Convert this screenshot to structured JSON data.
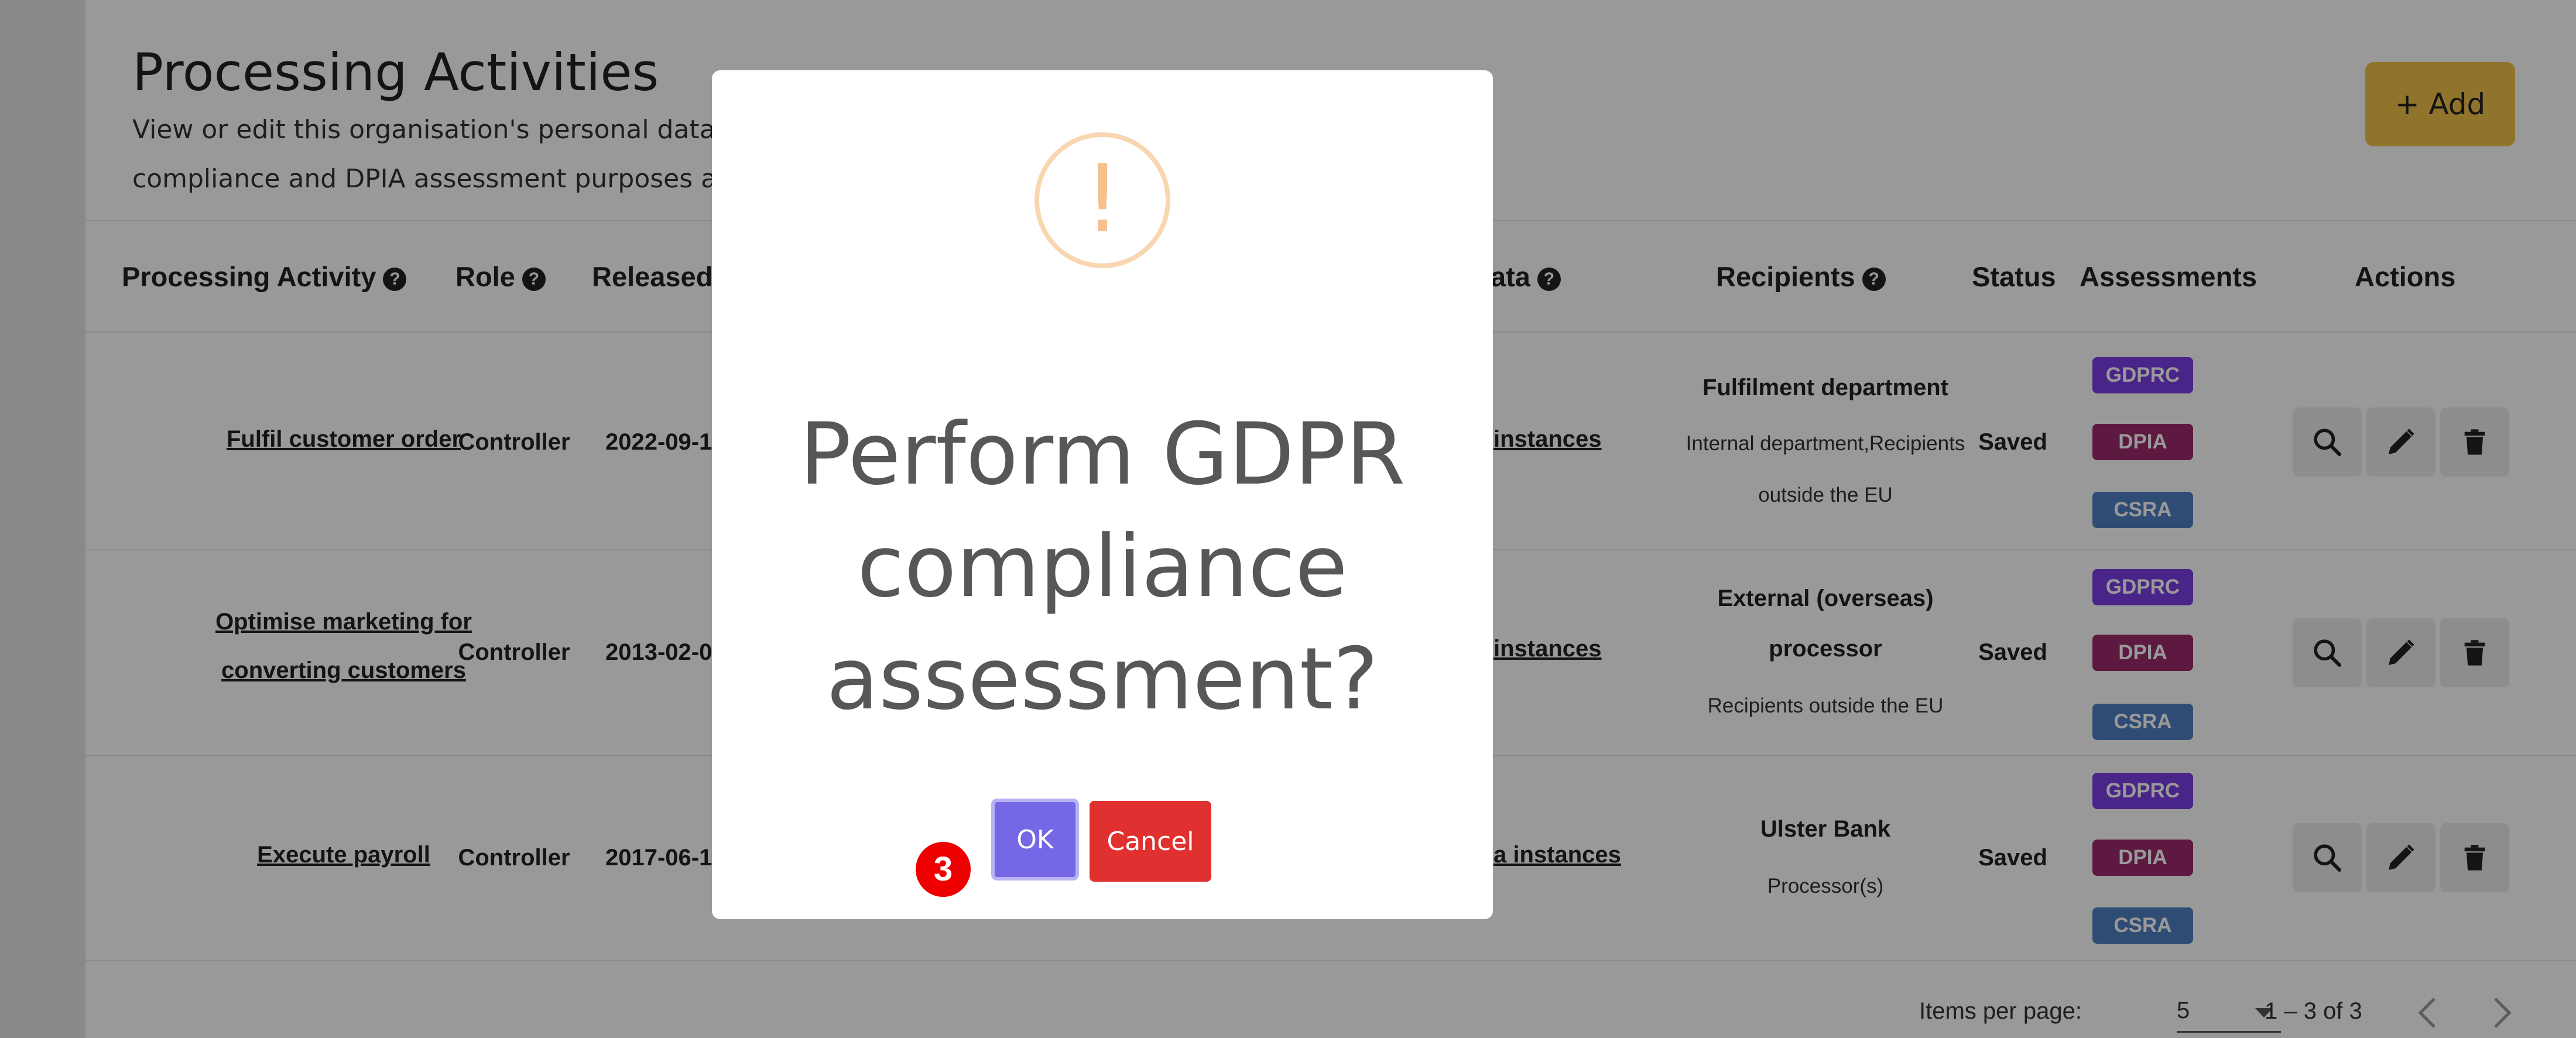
{
  "page": {
    "title": "Processing Activities",
    "description_line1": "View or edit this organisation's personal data proc",
    "description_line2": "compliance and DPIA assessment purposes as we",
    "add_label": "+ Add"
  },
  "table": {
    "headers": {
      "activity": "Processing Activity",
      "role": "Role",
      "released": "Released",
      "data": "ata",
      "recipients": "Recipients",
      "status": "Status",
      "assessments": "Assessments",
      "actions": "Actions"
    },
    "help_glyph": "?",
    "rows": [
      {
        "activity": "Fulfil customer order",
        "role": "Controller",
        "released": "2022-09-1",
        "data_link": "instances",
        "recipient_main": "Fulfilment department",
        "recipient_sub1": "Internal department,Recipients",
        "recipient_sub2": "outside the EU",
        "status": "Saved"
      },
      {
        "activity_line1": "Optimise marketing for",
        "activity_line2": "converting customers",
        "role": "Controller",
        "released": "2013-02-0",
        "data_link": "instances",
        "recipient_main_line1": "External (overseas)",
        "recipient_main_line2": "processor",
        "recipient_sub1": "Recipients outside the EU",
        "status": "Saved"
      },
      {
        "activity": "Execute payroll",
        "role": "Controller",
        "released": "2017-06-1",
        "data_link": "a instances",
        "recipient_main": "Ulster Bank",
        "recipient_sub1": "Processor(s)",
        "status": "Saved"
      }
    ],
    "badges": {
      "gdprc": "GDPRC",
      "dpia": "DPIA",
      "csra": "CSRA"
    },
    "action_icons": [
      "search-icon",
      "pencil-icon",
      "trash-icon"
    ]
  },
  "pagination": {
    "items_per_page_label": "Items per page:",
    "items_per_page_value": "5",
    "range": "1 – 3 of 3"
  },
  "modal": {
    "title_line1": "Perform GDPR",
    "title_line2": "compliance",
    "title_line3": "assessment?",
    "warning_glyph": "!",
    "ok_label": "OK",
    "cancel_label": "Cancel"
  },
  "step_marker": "3",
  "colors": {
    "accent_add": "#f0c24a",
    "ok_button": "#7468e6",
    "cancel_button": "#e0302f",
    "badge_gdprc": "#7b3fe4",
    "badge_dpia": "#9c2a6a",
    "badge_csra": "#4f7fc4",
    "step_marker": "#ee0000"
  }
}
